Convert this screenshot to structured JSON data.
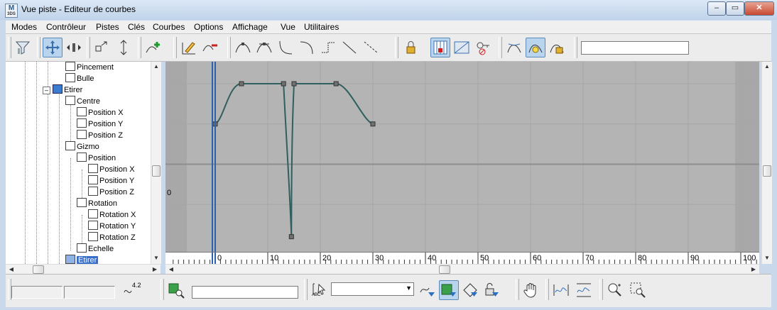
{
  "window": {
    "title": "Vue piste - Editeur de courbes",
    "app_icon_text": "M",
    "app_icon_sub": "3DS",
    "minimize_label": "–",
    "maximize_label": "▭",
    "close_label": "✕"
  },
  "menu": [
    "Modes",
    "Contrôleur",
    "Pistes",
    "Clés",
    "Courbes",
    "Options",
    "Affichage",
    "Vue",
    "Utilitaires"
  ],
  "toolbar": {
    "icons": [
      "filter-icon",
      "move-keys-icon",
      "slide-keys-icon",
      "scale-keys-icon",
      "scale-values-icon",
      "add-keys-icon",
      "draw-curves-icon",
      "reduce-keys-icon",
      "tangent-auto-icon",
      "tangent-custom-icon",
      "tangent-fast-icon",
      "tangent-slow-icon",
      "tangent-step-icon",
      "tangent-linear-icon",
      "tangent-smooth-icon",
      "lock-selection-icon",
      "snap-frames-icon",
      "parameter-curve-icon",
      "lock-tangents-icon",
      "show-tangents-icon",
      "show-all-tangents-icon",
      "lock-keys-icon"
    ],
    "field_value": ""
  },
  "tree": {
    "items": [
      {
        "label": "Pincement",
        "depth": 5,
        "icon": "track-icon"
      },
      {
        "label": "Bulle",
        "depth": 5,
        "icon": "track-icon"
      },
      {
        "label": "Etirer",
        "depth": 3,
        "icon": "modifier-icon",
        "expander": "–"
      },
      {
        "label": "Centre",
        "depth": 4,
        "icon": "position-icon"
      },
      {
        "label": "Position X",
        "depth": 5,
        "icon": "curve-icon"
      },
      {
        "label": "Position Y",
        "depth": 5,
        "icon": "curve-icon"
      },
      {
        "label": "Position Z",
        "depth": 5,
        "icon": "curve-icon"
      },
      {
        "label": "Gizmo",
        "depth": 4,
        "icon": "gizmo-icon"
      },
      {
        "label": "Position",
        "depth": 5,
        "icon": "position-icon"
      },
      {
        "label": "Position X",
        "depth": 6,
        "icon": "curve-icon"
      },
      {
        "label": "Position Y",
        "depth": 6,
        "icon": "curve-icon"
      },
      {
        "label": "Position Z",
        "depth": 6,
        "icon": "curve-icon"
      },
      {
        "label": "Rotation",
        "depth": 5,
        "icon": "rotation-icon"
      },
      {
        "label": "Rotation X",
        "depth": 6,
        "icon": "curve-icon"
      },
      {
        "label": "Rotation Y",
        "depth": 6,
        "icon": "curve-icon"
      },
      {
        "label": "Rotation Z",
        "depth": 6,
        "icon": "curve-icon"
      },
      {
        "label": "Echelle",
        "depth": 5,
        "icon": "scale-icon"
      },
      {
        "label": "Etirer",
        "depth": 4,
        "icon": "track-icon",
        "selected": true
      }
    ]
  },
  "graph": {
    "zero_label": "0",
    "ticks": [
      "0",
      "10",
      "20",
      "30",
      "40",
      "50",
      "60",
      "70",
      "80",
      "90",
      "100"
    ],
    "range_start": 0,
    "range_end": 100,
    "value_min": -1.0,
    "value_max": 1.0,
    "current_frame": 0,
    "curve_color": "#2f5f5f",
    "time_slider_color": "#2a62b0",
    "grid_color": "#a6a6a6",
    "background_color": "#b4b4b4",
    "keys": [
      {
        "frame": 0,
        "value": 0.5
      },
      {
        "frame": 5,
        "value": 1.0
      },
      {
        "frame": 13,
        "value": 1.0
      },
      {
        "frame": 14.5,
        "value": -0.9
      },
      {
        "frame": 15,
        "value": 1.0
      },
      {
        "frame": 23,
        "value": 1.0
      },
      {
        "frame": 30,
        "value": 0.5
      }
    ]
  },
  "status": {
    "field1": "",
    "field2": "",
    "curve_value_label": "4.2",
    "search_field": "",
    "combo_value": "",
    "abc_label": "ABC"
  }
}
